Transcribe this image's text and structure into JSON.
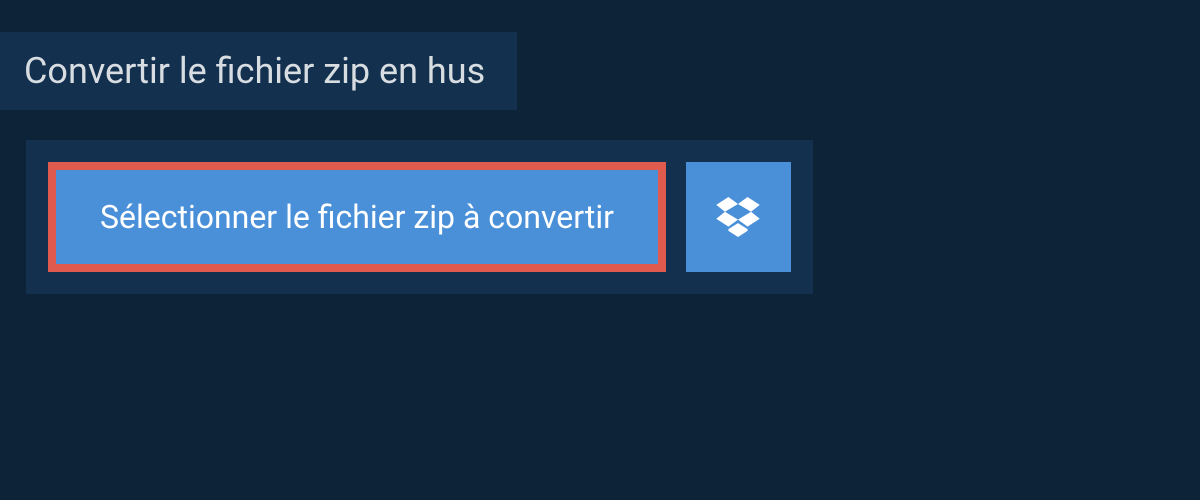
{
  "heading": {
    "text": "Convertir le fichier zip en hus"
  },
  "actions": {
    "select_file_label": "Sélectionner le fichier zip à convertir"
  },
  "colors": {
    "page_bg": "#0d2438",
    "panel_bg": "#13314f",
    "button_bg": "#4a90d9",
    "highlight_border": "#e15a4e",
    "text_light": "#d8dde2",
    "text_white": "#ffffff"
  }
}
